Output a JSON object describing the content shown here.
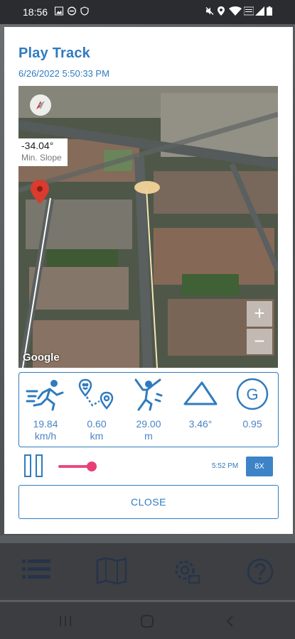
{
  "status_bar": {
    "time": "18:56"
  },
  "dialog": {
    "title": "Play Track",
    "date": "6/26/2022 5:50:33 PM"
  },
  "map": {
    "slope_value": "-34.04°",
    "slope_label": "Min. Slope",
    "zoom_in": "+",
    "zoom_out": "−",
    "attribution": "Google"
  },
  "stats": [
    {
      "icon": "running-icon",
      "value": "19.84\nkm/h"
    },
    {
      "icon": "route-distance-icon",
      "value": "0.60\nkm"
    },
    {
      "icon": "climber-icon",
      "value": "29.00\nm"
    },
    {
      "icon": "slope-triangle-icon",
      "value": "3.46°"
    },
    {
      "icon": "g-force-icon",
      "value": "0.95"
    }
  ],
  "player": {
    "time": "5:52 PM",
    "speed": "8X"
  },
  "close_label": "CLOSE",
  "colors": {
    "accent": "#2f7bbf",
    "slider": "#e83e78"
  }
}
